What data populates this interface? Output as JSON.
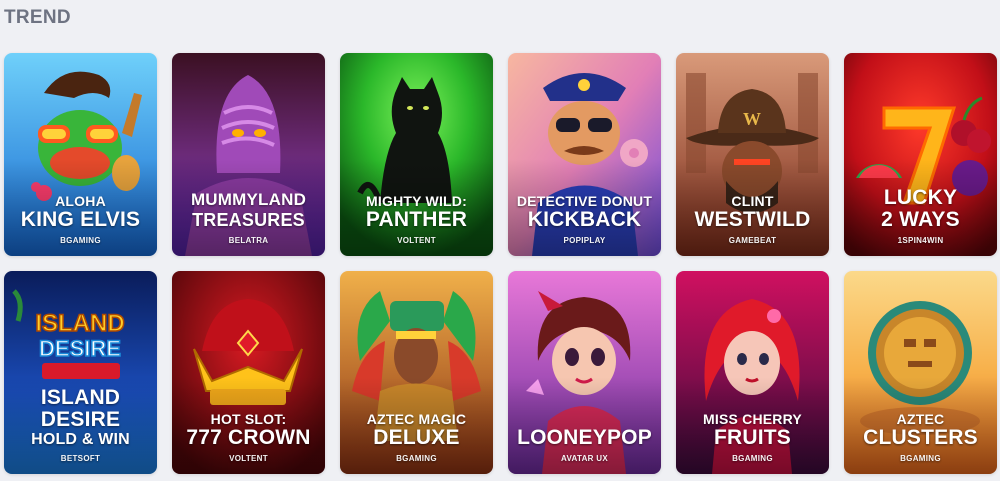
{
  "section": {
    "title": "TREND"
  },
  "games": [
    {
      "line1": "ALOHA",
      "line2": "KING ELVIS",
      "provider": "BGAMING",
      "art": "frog-elvis-icon",
      "bg": [
        "#5bc0f0",
        "#1b6fd1"
      ]
    },
    {
      "line1": "MUMMYLAND",
      "line2": "TREASURES",
      "provider": "BELATRA",
      "art": "mummy-icon",
      "bg": [
        "#7a2c8c",
        "#3c1356"
      ]
    },
    {
      "line1": "MIGHTY WILD:",
      "line2": "PANTHER",
      "provider": "VOLTENT",
      "art": "panther-icon",
      "bg": [
        "#3fd53b",
        "#0a5a10"
      ]
    },
    {
      "line1": "DETECTIVE DONUT",
      "line2": "KICKBACK",
      "provider": "POPIPLAY",
      "art": "police-dog-icon",
      "bg": [
        "#f2a0a0",
        "#7b4bd8"
      ]
    },
    {
      "line1": "CLINT",
      "line2": "WESTWILD",
      "provider": "GAMEBEAT",
      "art": "cowboy-icon",
      "bg": [
        "#c9795c",
        "#6e2416"
      ]
    },
    {
      "line1": "LUCKY",
      "line2": "2 WAYS",
      "provider": "1SPIN4WIN",
      "art": "lucky-seven-icon",
      "bg": [
        "#c7121a",
        "#5a0408"
      ]
    },
    {
      "line1": "ISLAND",
      "line2": "DESIRE",
      "line3": "HOLD & WIN",
      "provider": "BETSOFT",
      "art": "island-desire-logo-icon",
      "bg": [
        "#0e2d86",
        "#1a63d1"
      ]
    },
    {
      "line1": "HOT SLOT:",
      "line2": "777 CROWN",
      "provider": "VOLTENT",
      "art": "crown-icon",
      "bg": [
        "#b3101b",
        "#4a0508"
      ]
    },
    {
      "line1": "AZTEC MAGIC",
      "line2": "DELUXE",
      "provider": "BGAMING",
      "art": "aztec-warrior-icon",
      "bg": [
        "#e0962e",
        "#7a2810"
      ]
    },
    {
      "line1": "",
      "line2": "LOONEYPOP",
      "provider": "AVATAR UX",
      "art": "cartoon-girl-icon",
      "bg": [
        "#d664d8",
        "#5a1a80"
      ]
    },
    {
      "line1": "MISS CHERRY",
      "line2": "FRUITS",
      "provider": "BGAMING",
      "art": "cherry-girl-icon",
      "bg": [
        "#c01058",
        "#3c0a3a"
      ]
    },
    {
      "line1": "AZTEC",
      "line2": "CLUSTERS",
      "provider": "BGAMING",
      "art": "aztec-medallion-icon",
      "bg": [
        "#f8c45c",
        "#e06a1c"
      ]
    }
  ]
}
